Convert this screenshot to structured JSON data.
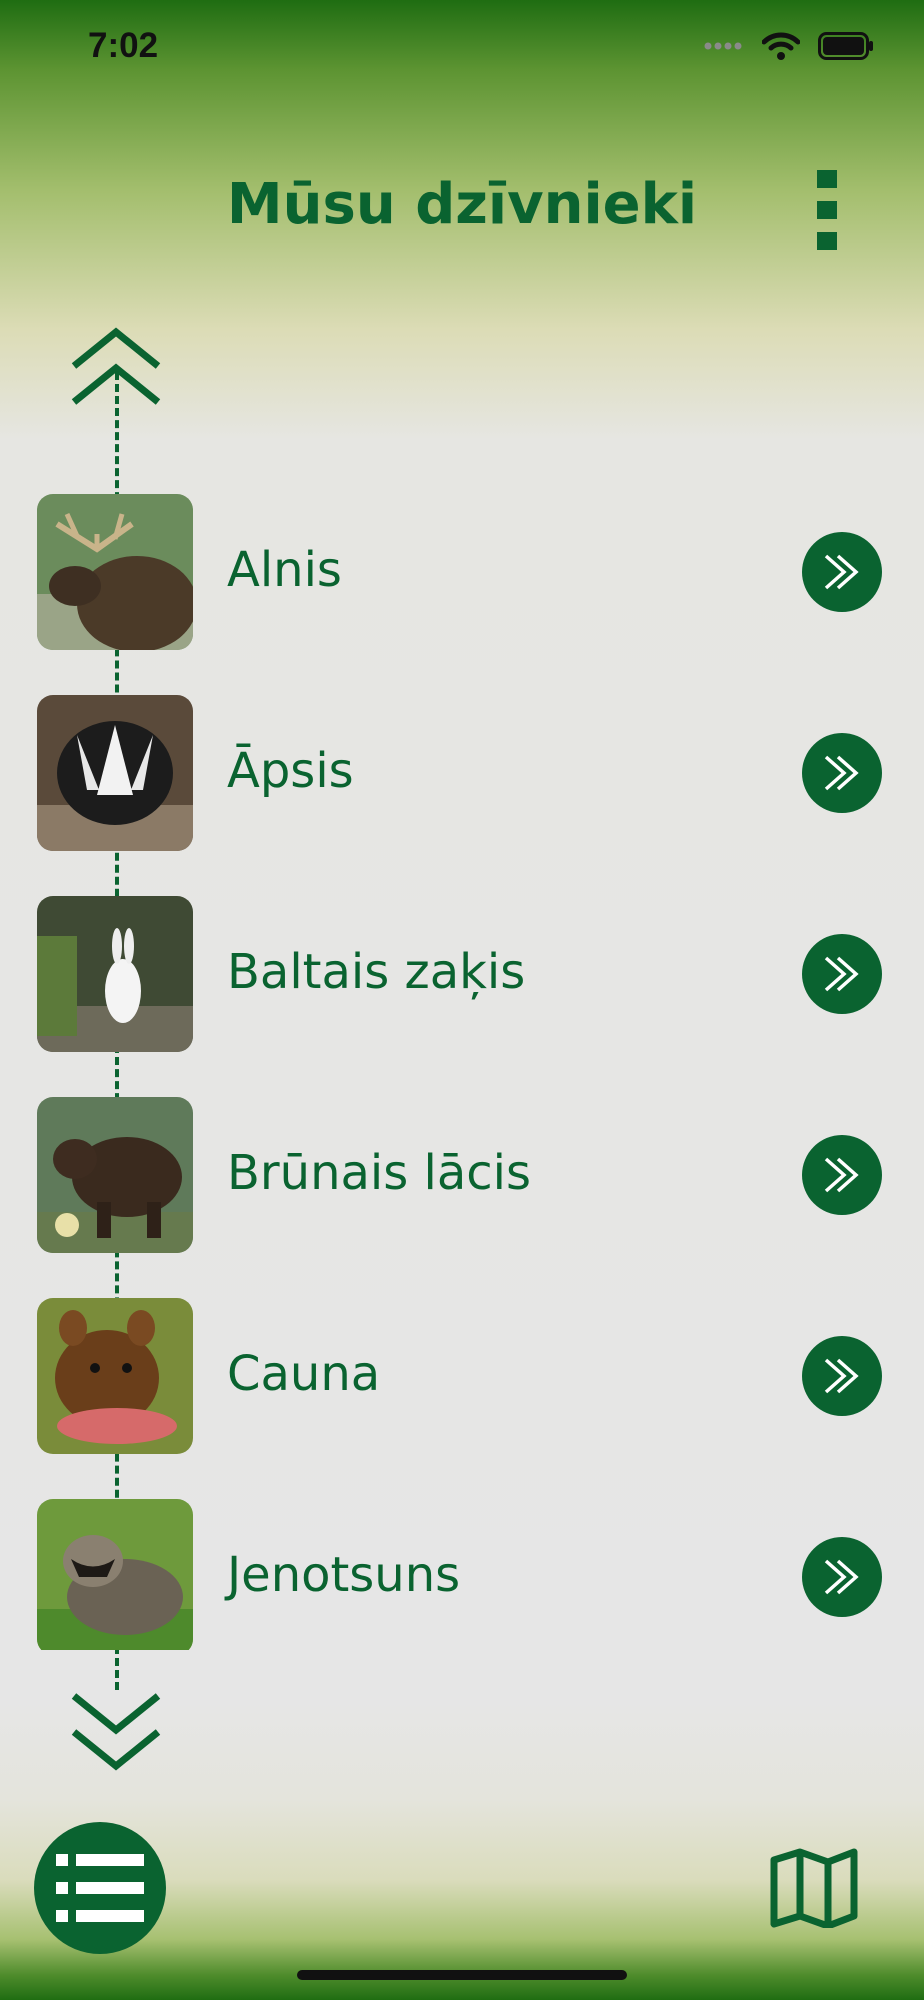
{
  "status": {
    "time": "7:02"
  },
  "header": {
    "title": "Mūsu dzīvnieki",
    "menu_icon": "kebab-menu-icon"
  },
  "colors": {
    "primary": "#0a6330",
    "background": "#e6e6e6"
  },
  "animals": [
    {
      "name": "Alnis",
      "thumb": "moose"
    },
    {
      "name": "Āpsis",
      "thumb": "badger"
    },
    {
      "name": "Baltais zaķis",
      "thumb": "white-hare"
    },
    {
      "name": "Brūnais lācis",
      "thumb": "brown-bear"
    },
    {
      "name": "Cauna",
      "thumb": "marten"
    },
    {
      "name": "Jenotsuns",
      "thumb": "raccoon-dog"
    }
  ],
  "bottom": {
    "list_icon": "list-icon",
    "map_icon": "map-icon"
  }
}
